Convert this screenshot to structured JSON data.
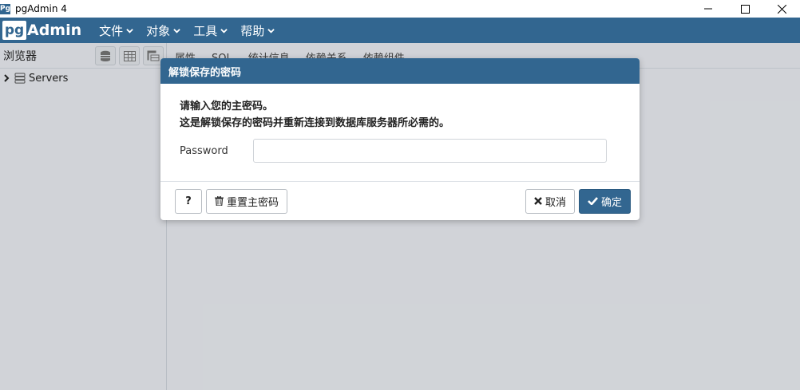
{
  "window": {
    "title": "pgAdmin 4",
    "icon_label": "Pg"
  },
  "navbar": {
    "brand_pg": "pg",
    "brand_admin": "Admin",
    "menu": [
      {
        "label": "文件"
      },
      {
        "label": "对象"
      },
      {
        "label": "工具"
      },
      {
        "label": "帮助"
      }
    ]
  },
  "browser": {
    "title": "浏览器",
    "tree": [
      {
        "label": "Servers",
        "expanded": false
      }
    ]
  },
  "main": {
    "tabs": [
      {
        "label": "属性"
      },
      {
        "label": "SQL"
      },
      {
        "label": "统计信息"
      },
      {
        "label": "依赖关系"
      },
      {
        "label": "依赖组件"
      }
    ]
  },
  "dialog": {
    "title": "解锁保存的密码",
    "message_line1": "请输入您的主密码。",
    "message_line2": "这是解锁保存的密码并重新连接到数据库服务器所必需的。",
    "password_label": "Password",
    "password_value": "",
    "help_label": "?",
    "reset_label": "重置主密码",
    "cancel_label": "取消",
    "ok_label": "确定"
  },
  "colors": {
    "brand_blue": "#326690",
    "panel_bg": "#ebeef3"
  }
}
